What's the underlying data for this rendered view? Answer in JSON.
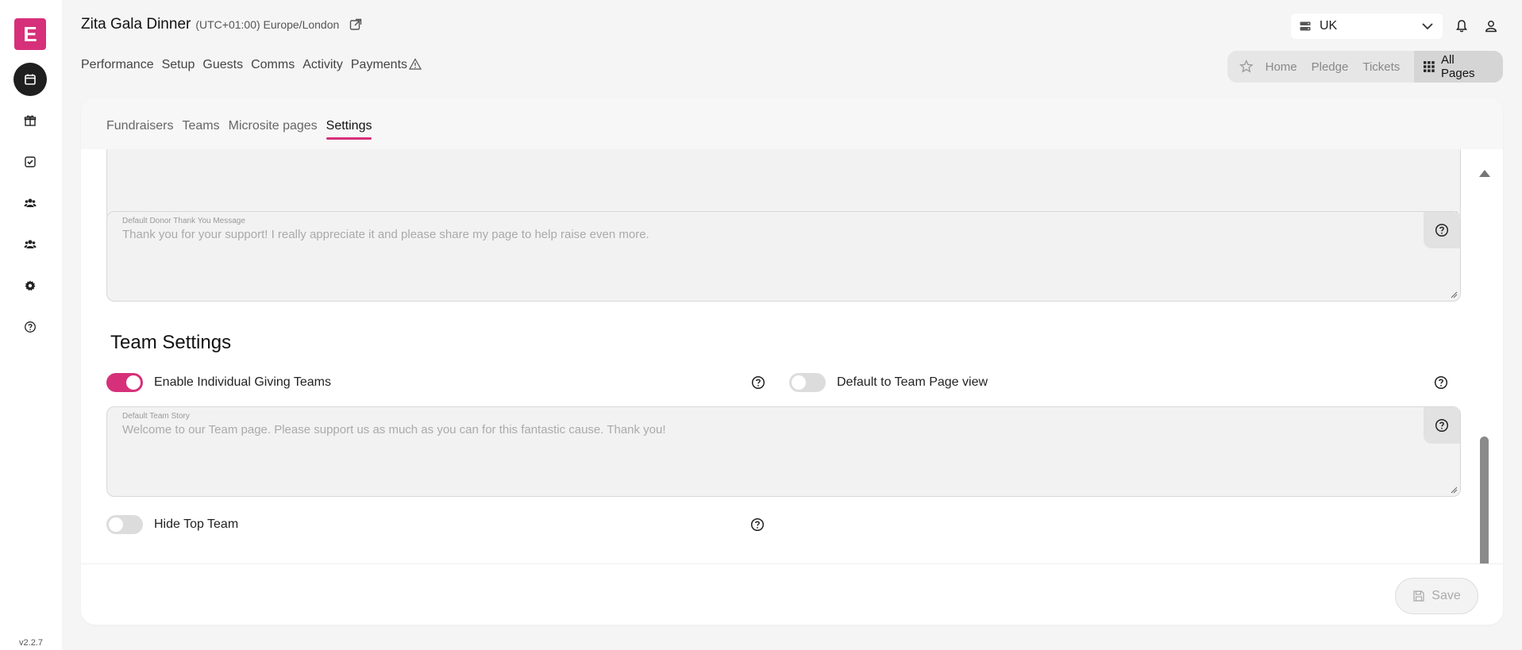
{
  "app": {
    "logo_letter": "E",
    "version": "v2.2.7",
    "accent_color": "#d6307a"
  },
  "rail": {
    "items": [
      {
        "name": "calendar-icon",
        "active": true
      },
      {
        "name": "gift-icon",
        "active": false
      },
      {
        "name": "checkbox-icon",
        "active": false
      },
      {
        "name": "users-icon",
        "active": false
      },
      {
        "name": "team-icon",
        "active": false
      },
      {
        "name": "gear-icon",
        "active": false
      },
      {
        "name": "help-icon",
        "active": false
      }
    ]
  },
  "header": {
    "event_title": "Zita Gala Dinner",
    "timezone": "(UTC+01:00) Europe/London",
    "nav": [
      "Performance",
      "Setup",
      "Guests",
      "Comms",
      "Activity",
      "Payments"
    ],
    "region": "UK",
    "pages": [
      "Home",
      "Pledge",
      "Tickets"
    ],
    "all_pages_label": "All Pages"
  },
  "tabs": [
    "Fundraisers",
    "Teams",
    "Microsite pages",
    "Settings"
  ],
  "active_tab": "Settings",
  "donor_message": {
    "label": "Default Donor Thank You Message",
    "placeholder": "Thank you for your support! I really appreciate it and please share my page to help raise even more."
  },
  "team_settings": {
    "title": "Team Settings",
    "enable_individual_giving_teams": {
      "label": "Enable Individual Giving Teams",
      "on": true
    },
    "default_team_page_view": {
      "label": "Default to Team Page view",
      "on": false
    },
    "team_story": {
      "label": "Default Team Story",
      "placeholder": "Welcome to our Team page. Please support us as much as you can for this fantastic cause. Thank you!"
    },
    "hide_top_team": {
      "label": "Hide Top Team",
      "on": false
    }
  },
  "footer": {
    "save_label": "Save"
  }
}
